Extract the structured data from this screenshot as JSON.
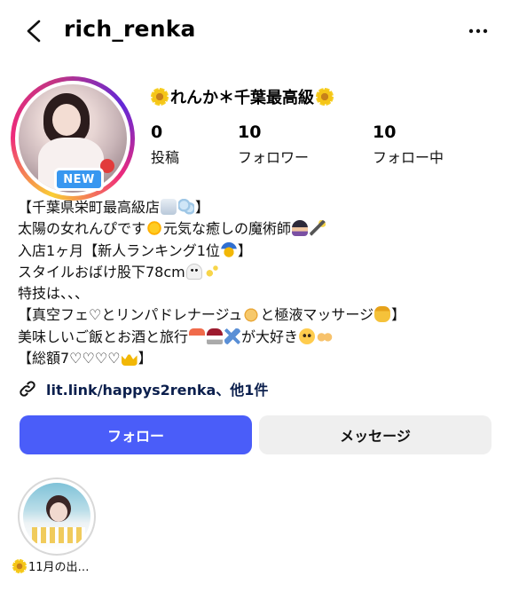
{
  "header": {
    "username": "rich_renka"
  },
  "profile": {
    "display_name": "れんか＊千葉最高級",
    "badge": "NEW",
    "stats": [
      {
        "value": "0",
        "label": "投稿"
      },
      {
        "value": "10",
        "label": "フォロワー"
      },
      {
        "value": "10",
        "label": "フォロー中"
      }
    ]
  },
  "bio": {
    "line1": "【千葉県栄町最高級店",
    "line1_end": "】",
    "line2": "太陽の女れんぴです",
    "line2_b": "元気な癒しの魔術師",
    "line3": "入店1ヶ月【新人ランキング1位",
    "line3_end": "】",
    "line4": "スタイルおばけ股下78cm",
    "line5": "特技は、、、",
    "line6": "【真空フェ♡とリンパドレナージュ",
    "line6_b": "と極液マッサージ",
    "line6_end": "】",
    "line7": "美味しいご飯とお酒と旅行",
    "line7_b": "が大好き",
    "line8": "【総額7♡♡♡♡"
  },
  "link": {
    "text": "lit.link/happys2renka、他1件",
    "icon": "link-icon"
  },
  "actions": {
    "follow_label": "フォロー",
    "message_label": "メッセージ",
    "follow_color": "#4a5df9",
    "message_color": "#efefef"
  },
  "highlights": [
    {
      "label": "11月の出…"
    }
  ]
}
